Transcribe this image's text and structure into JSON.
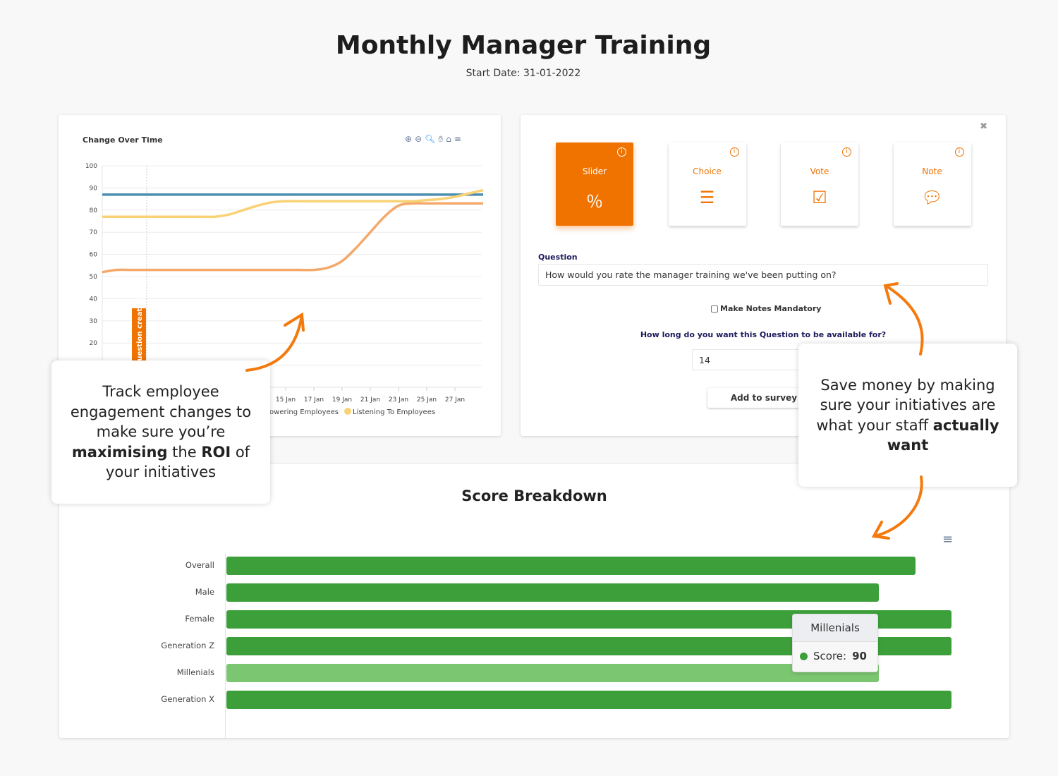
{
  "header": {
    "title": "Monthly Manager Training",
    "subtitle": "Start Date: 31-01-2022"
  },
  "line_chart_card": {
    "toolbar_icons": [
      "zoom-in-icon",
      "zoom-out-icon",
      "selection-zoom-icon",
      "pan-hand-icon",
      "home-reset-icon",
      "menu-icon"
    ],
    "marker_label": "Question created"
  },
  "chart_data": [
    {
      "type": "line",
      "title": "Change Over Time",
      "ylim": [
        0,
        100
      ],
      "yticks": [
        20,
        30,
        40,
        50,
        60,
        70,
        80,
        90,
        100
      ],
      "x_tick_labels": [
        "15 Jan",
        "17 Jan",
        "19 Jan",
        "21 Jan",
        "23 Jan",
        "25 Jan",
        "27 Jan"
      ],
      "x_days": [
        2,
        3,
        4,
        5,
        6,
        7,
        8,
        9,
        10,
        11,
        12,
        13,
        14,
        15,
        16,
        17,
        18,
        19,
        20,
        21,
        22,
        23,
        24,
        25,
        26,
        27,
        28,
        29
      ],
      "grid": true,
      "legend_placement": "bottom",
      "series": [
        {
          "name": "",
          "color": "#4a8fb0",
          "values": [
            87,
            87,
            87,
            87,
            87,
            87,
            87,
            87,
            87,
            87,
            87,
            87,
            87,
            87,
            87,
            87,
            87,
            87,
            87,
            87,
            87,
            87,
            87,
            87,
            87,
            87,
            87,
            87
          ]
        },
        {
          "name": "Empowering Employees",
          "color": "#f4a96a",
          "values": [
            52,
            53,
            53,
            53,
            53,
            53,
            53,
            53,
            53,
            53,
            53,
            53,
            53,
            53,
            53,
            53,
            54,
            57,
            63,
            70,
            77,
            82,
            83,
            83,
            83,
            83,
            83,
            83
          ]
        },
        {
          "name": "Listening To Employees",
          "color": "#f8d274",
          "values": [
            77,
            77,
            77,
            77,
            77,
            77,
            77,
            77,
            77,
            78,
            80,
            82,
            83.5,
            84,
            84,
            84,
            84,
            84,
            84,
            84,
            84,
            84,
            84,
            84.5,
            85,
            86,
            87.5,
            89
          ]
        }
      ]
    },
    {
      "type": "bar",
      "title": "Score Breakdown",
      "orientation": "horizontal",
      "xlim": [
        0,
        100
      ],
      "categories": [
        "Overall",
        "Male",
        "Female",
        "Generation Z",
        "Millenials",
        "Generation X"
      ],
      "values": [
        95,
        90,
        100,
        100,
        90,
        100
      ],
      "color": "#3c9f3a",
      "highlight_color": "#7bc670",
      "highlighted": "Millenials",
      "tooltip": {
        "title": "Millenials",
        "label": "Score:",
        "value": "90"
      }
    }
  ],
  "question_panel": {
    "types": [
      {
        "label": "Slider",
        "icon": "percent-icon",
        "selected": true
      },
      {
        "label": "Choice",
        "icon": "list-icon",
        "selected": false
      },
      {
        "label": "Vote",
        "icon": "ballot-check-icon",
        "selected": false
      },
      {
        "label": "Note",
        "icon": "speech-bubble-icon",
        "selected": false
      }
    ],
    "question_label": "Question",
    "question_value": "How would you rate the manager training we've been putting on?",
    "mandatory_label": "Make Notes Mandatory",
    "mandatory_checked": false,
    "duration_label": "How long do you want this Question to be available for?",
    "duration_value": "14",
    "add_button": "Add to survey"
  },
  "callouts": {
    "left": {
      "t1": "Track employee engagement changes to make sure you’re ",
      "b1": "maximising",
      "t2": " the ",
      "b2": "ROI",
      "t3": " of your initiatives"
    },
    "right": {
      "t1": "Save money by making sure your initiatives are what your staff ",
      "b1": "actually want"
    }
  },
  "colors": {
    "accent": "#f07300",
    "navy": "#1c1a5c",
    "bar": "#3c9f3a"
  }
}
